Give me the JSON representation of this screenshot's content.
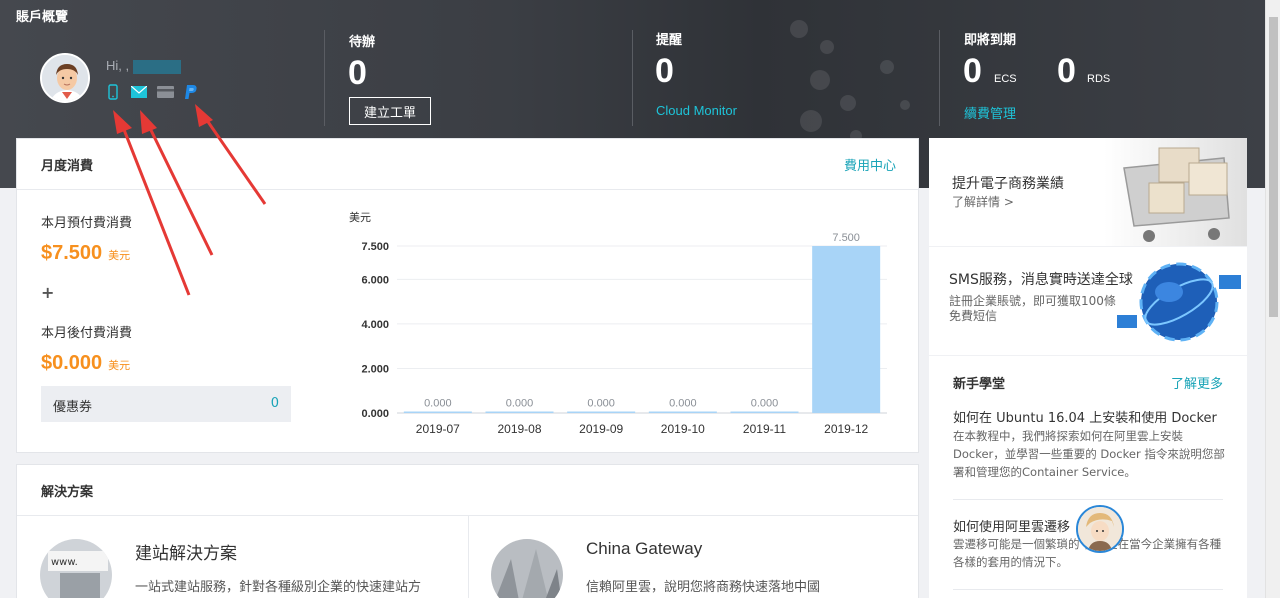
{
  "header": {
    "page_title": "賬戶概覽",
    "greeting": "Hi, ,",
    "contact_icons": [
      "mobile-icon",
      "email-icon",
      "card-icon",
      "paypal-icon"
    ],
    "todo": {
      "label": "待辦",
      "value": "0",
      "button": "建立工單"
    },
    "alerts": {
      "label": "提醒",
      "value": "0",
      "link": "Cloud Monitor"
    },
    "expiring": {
      "label": "即將到期",
      "ecs_value": "0",
      "ecs_unit": "ECS",
      "rds_value": "0",
      "rds_unit": "RDS",
      "link": "續費管理"
    }
  },
  "monthly": {
    "title": "月度消費",
    "billing_link": "費用中心",
    "prepaid_label": "本月預付費消費",
    "prepaid_amount": "$7.500",
    "currency": "美元",
    "plus": "+",
    "postpaid_label": "本月後付費消費",
    "postpaid_amount": "$0.000",
    "coupon_label": "優惠券",
    "coupon_value": "0"
  },
  "chart_data": {
    "type": "bar",
    "ylabel": "美元",
    "categories": [
      "2019-07",
      "2019-08",
      "2019-09",
      "2019-10",
      "2019-11",
      "2019-12"
    ],
    "values": [
      0.0,
      0.0,
      0.0,
      0.0,
      0.0,
      7.5
    ],
    "value_labels": [
      "0.000",
      "0.000",
      "0.000",
      "0.000",
      "0.000",
      "7.500"
    ],
    "yticks": [
      "0.000",
      "2.000",
      "4.000",
      "6.000",
      "7.500"
    ],
    "ytick_values": [
      0,
      2,
      4,
      6,
      7.5
    ],
    "ylim": [
      0,
      7.5
    ],
    "grid": true,
    "bar_color": "#a8d4f7"
  },
  "solutions": {
    "title": "解決方案",
    "items": [
      {
        "title": "建站解決方案",
        "desc": "一站式建站服務，針對各種級別企業的快速建站方",
        "img_text": "www."
      },
      {
        "title": "China Gateway",
        "desc": "信賴阿里雲，說明您將商務快速落地中國"
      }
    ]
  },
  "promos": [
    {
      "title": "提升電子商務業績",
      "sub": "了解詳情 >"
    },
    {
      "title": "SMS服務，消息實時送達全球",
      "sub": "註冊企業賬號，即可獲取100條免費短信"
    }
  ],
  "learning": {
    "title": "新手學堂",
    "more": "了解更多",
    "articles": [
      {
        "title": "如何在 Ubuntu 16.04 上安裝和使用 Docker",
        "body": "在本教程中，我們將探索如何在阿里雲上安裝Docker，並學習一些重要的 Docker 指令來說明您部署和管理您的Container Service。"
      },
      {
        "title": "如何使用阿里雲遷移",
        "body": "雲遷移可能是一個繁瑣的 特別是在當今企業擁有各種各樣的套用的情況下。"
      }
    ]
  },
  "colors": {
    "accent_cyan": "#1ec4d9",
    "link_teal": "#18a3b7",
    "amount_orange": "#f7901e",
    "arrow_red": "#e53935"
  }
}
